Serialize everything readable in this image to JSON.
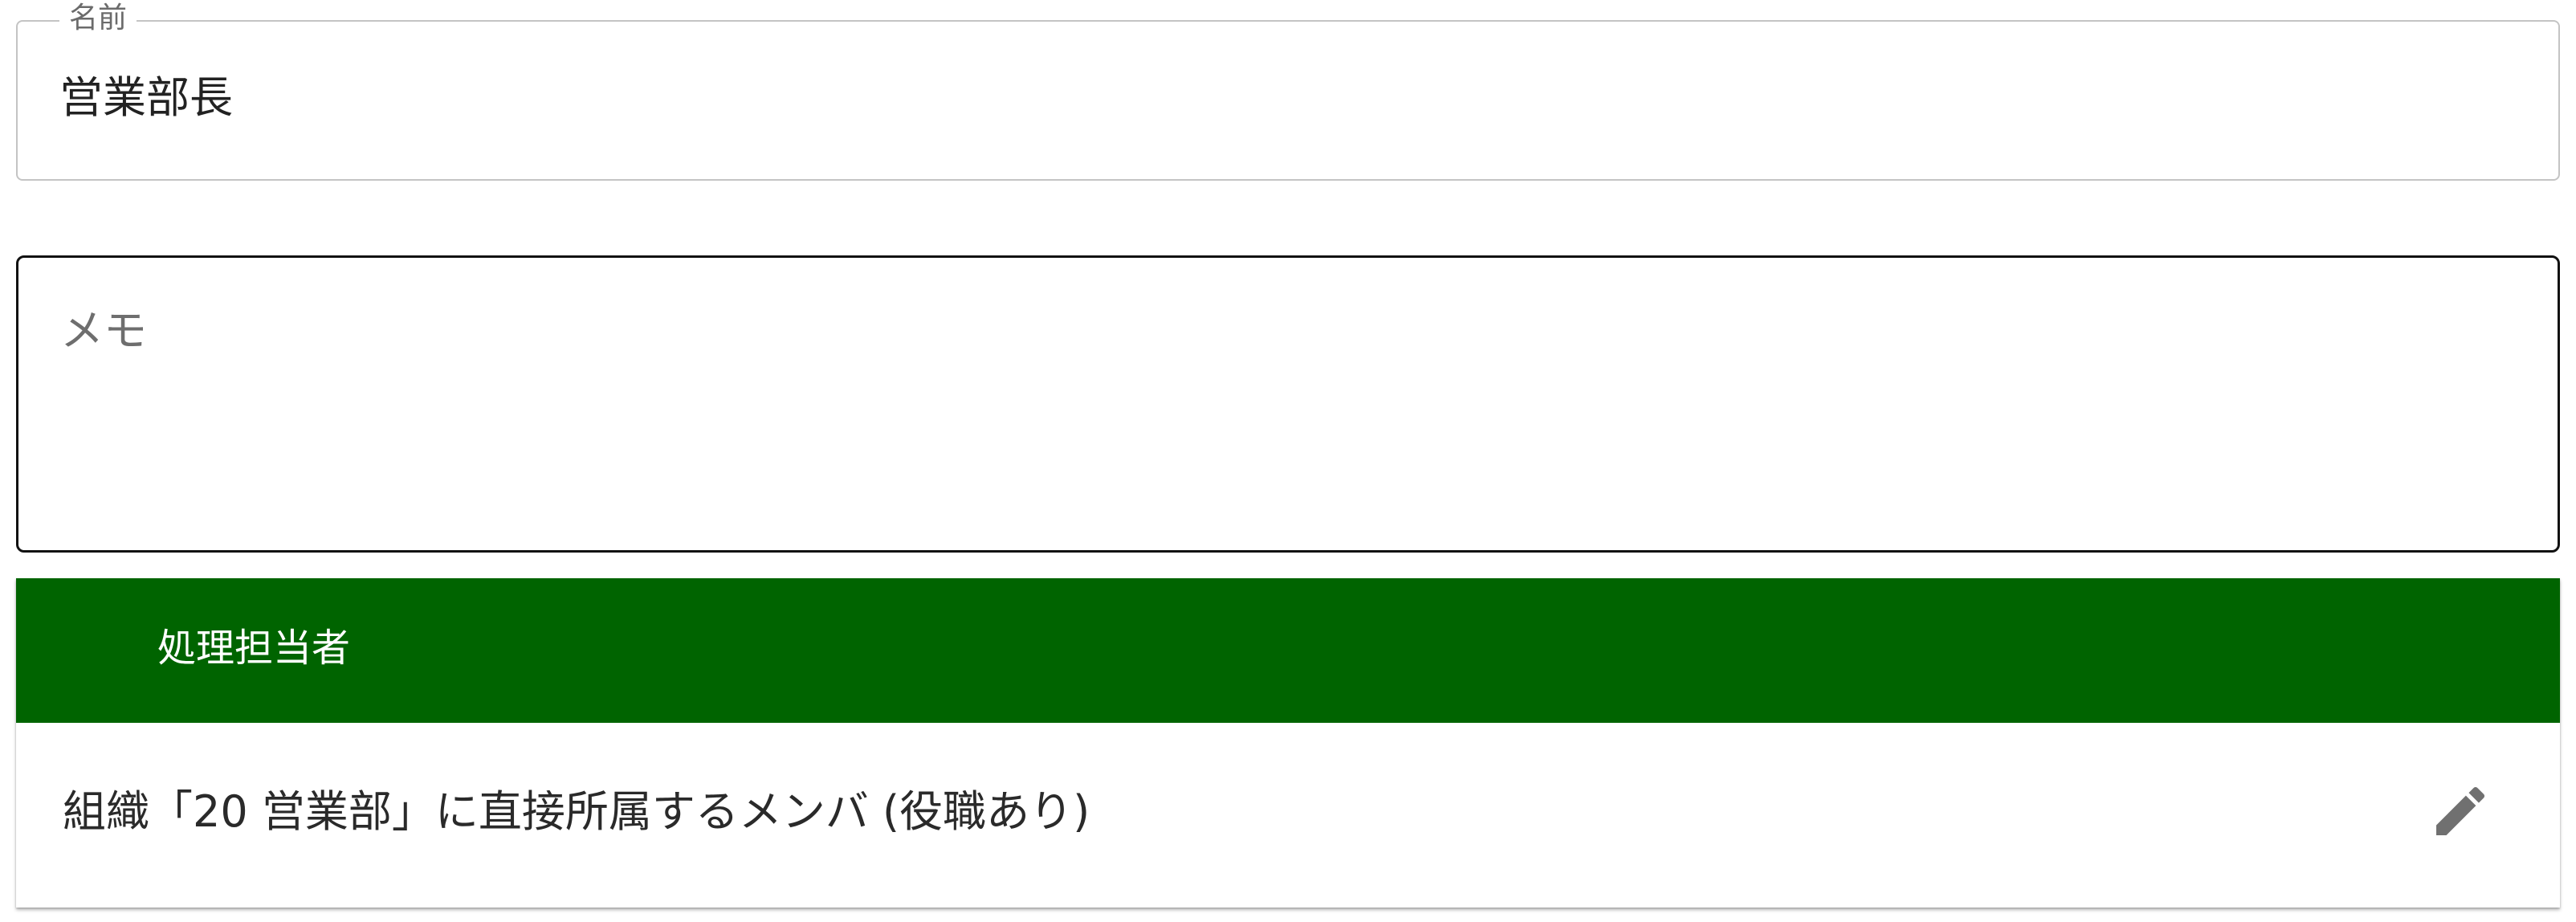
{
  "name_field": {
    "label": "名前",
    "value": "営業部長"
  },
  "memo_field": {
    "placeholder": "メモ"
  },
  "assignee_section": {
    "title": "処理担当者",
    "header_color": "#006400",
    "assignee_text": "組織「20 営業部」に直接所属するメンバ (役職あり)",
    "edit_icon": "pencil-icon"
  }
}
